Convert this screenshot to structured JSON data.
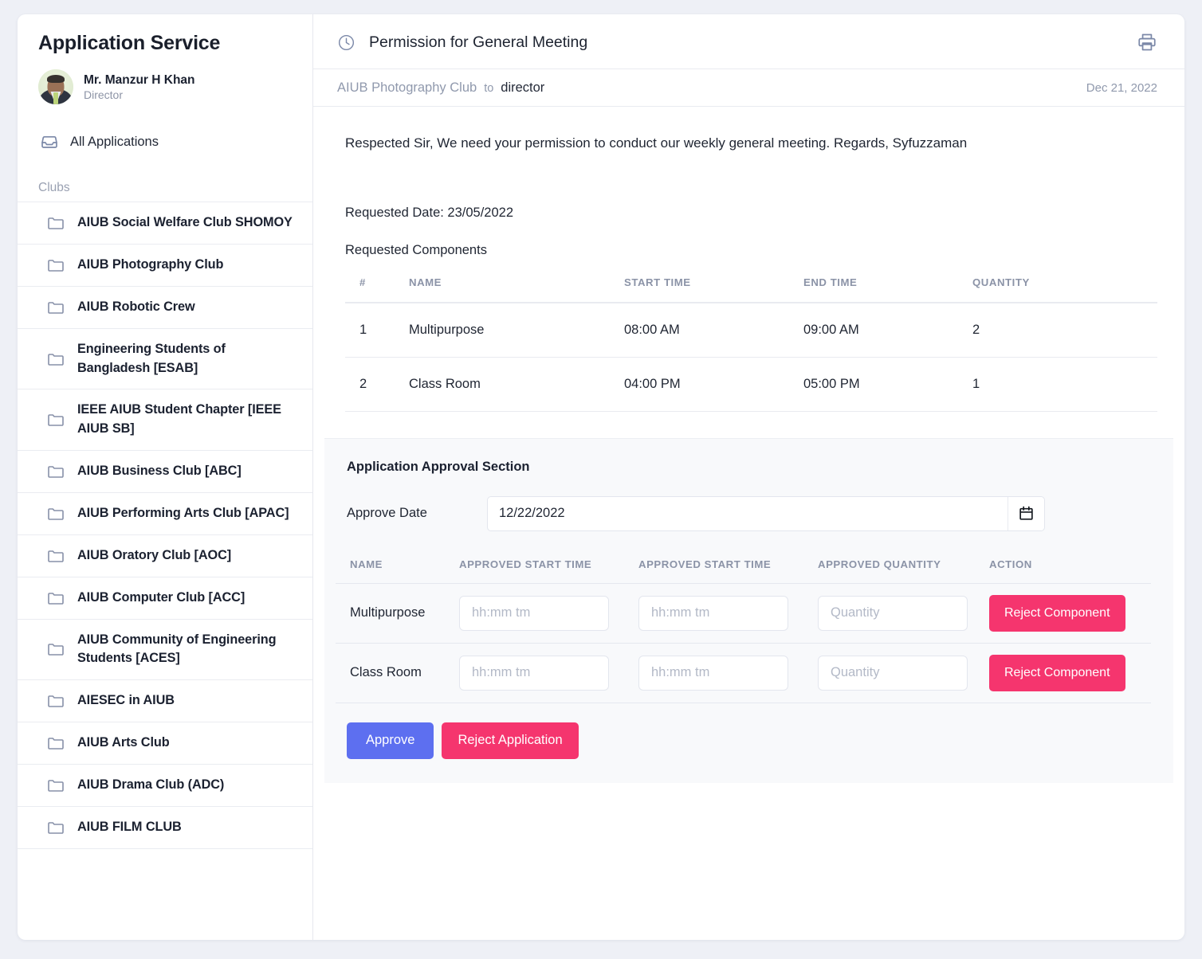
{
  "sidebar": {
    "app_title": "Application Service",
    "user": {
      "name": "Mr. Manzur H Khan",
      "role": "Director"
    },
    "nav": {
      "all_applications": "All Applications",
      "inbox_icon": "inbox-icon"
    },
    "section_label": "Clubs",
    "clubs": [
      {
        "name": "AIUB Social Welfare Club SHOMOY"
      },
      {
        "name": "AIUB Photography Club"
      },
      {
        "name": "AIUB Robotic Crew"
      },
      {
        "name": "Engineering Students of Bangladesh [ESAB]"
      },
      {
        "name": "IEEE AIUB Student Chapter [IEEE AIUB SB]"
      },
      {
        "name": "AIUB Business Club [ABC]"
      },
      {
        "name": "AIUB Performing Arts Club [APAC]"
      },
      {
        "name": "AIUB Oratory Club [AOC]"
      },
      {
        "name": "AIUB Computer Club [ACC]"
      },
      {
        "name": "AIUB Community of Engineering Students [ACES]"
      },
      {
        "name": "AIESEC in AIUB"
      },
      {
        "name": "AIUB Arts Club"
      },
      {
        "name": "AIUB Drama Club (ADC)"
      },
      {
        "name": "AIUB FILM CLUB"
      }
    ]
  },
  "main": {
    "title": "Permission for General Meeting",
    "title_icon": "clock-icon",
    "print_icon": "print-icon",
    "meta": {
      "from": "AIUB Photography Club",
      "to_word": "to",
      "destination": "director",
      "date": "Dec 21, 2022"
    },
    "message": "Respected Sir, We need your permission to conduct our weekly general meeting. Regards, Syfuzzaman",
    "requested_date_line": "Requested Date: 23/05/2022",
    "requested_components_label": "Requested Components",
    "components_table": {
      "headers": [
        "#",
        "NAME",
        "START TIME",
        "END TIME",
        "QUANTITY"
      ],
      "rows": [
        {
          "index": "1",
          "name": "Multipurpose",
          "start": "08:00 AM",
          "end": "09:00 AM",
          "quantity": "2"
        },
        {
          "index": "2",
          "name": "Class Room",
          "start": "04:00 PM",
          "end": "05:00 PM",
          "quantity": "1"
        }
      ]
    },
    "approval": {
      "title": "Application Approval Section",
      "approve_date_label": "Approve Date",
      "approve_date_value": "12/22/2022",
      "calendar_icon": "calendar-icon",
      "headers": [
        "NAME",
        "APPROVED START TIME",
        "APPROVED START TIME",
        "APPROVED QUANTITY",
        "ACTION"
      ],
      "placeholders": {
        "time": "hh:mm tm",
        "quantity": "Quantity"
      },
      "rows": [
        {
          "name": "Multipurpose",
          "reject_label": "Reject Component"
        },
        {
          "name": "Class Room",
          "reject_label": "Reject Component"
        }
      ],
      "approve_label": "Approve",
      "reject_application_label": "Reject Application"
    }
  },
  "colors": {
    "accent_blue": "#5d6ff0",
    "accent_pink": "#f5356e",
    "page_bg": "#eef0f6",
    "panel_bg": "#f8f9fb",
    "muted_text": "#8b93a7"
  }
}
